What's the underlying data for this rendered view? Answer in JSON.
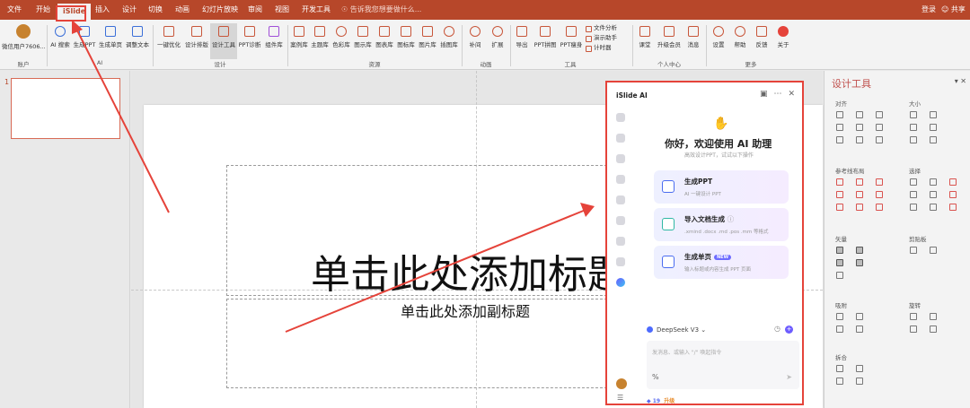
{
  "menubar": {
    "tabs": [
      "文件",
      "开始",
      "iSlide",
      "插入",
      "设计",
      "切换",
      "动画",
      "幻灯片放映",
      "审阅",
      "视图",
      "开发工具"
    ],
    "active_tab": "iSlide",
    "search_placeholder": "告诉我您想要做什么...",
    "login": "登录",
    "share": "共享"
  },
  "ribbon": {
    "account": {
      "user": "微信用户7606...",
      "group": "账户"
    },
    "ai": {
      "items": [
        "AI 搜索",
        "生成PPT",
        "生成单页",
        "调整文本"
      ],
      "group": "AI"
    },
    "design": {
      "items": [
        "一键优化",
        "设计排版",
        "设计工具",
        "PPT诊断",
        "组件库"
      ],
      "group": "设计"
    },
    "resources": {
      "items": [
        "案例库",
        "主题库",
        "色彩库",
        "图示库",
        "图表库",
        "图标库",
        "图片库",
        "插图库"
      ],
      "group": "资源"
    },
    "animation": {
      "items": [
        "补间",
        "扩展"
      ],
      "group": "动画"
    },
    "tools": {
      "items": [
        "导出",
        "PPT拼图",
        "PPT瘦身"
      ],
      "list": [
        "文件分析",
        "演示助手",
        "计时器"
      ],
      "group": "工具"
    },
    "personal": {
      "items": [
        "课堂",
        "升级会员",
        "消息"
      ],
      "group": "个人中心"
    },
    "more": {
      "items": [
        "设置",
        "帮助",
        "反馈",
        "关于"
      ],
      "group": "更多"
    }
  },
  "thumbnails": {
    "slide_number": "1"
  },
  "slide": {
    "title": "单击此处添加标题",
    "subtitle": "单击此处添加副标题"
  },
  "ai_panel": {
    "title": "iSlide AI",
    "greeting_icon": "waving-hand-icon",
    "greeting": "你好，欢迎使用 AI 助理",
    "hint": "高效设计PPT，试试以下操作",
    "cards": [
      {
        "title": "生成PPT",
        "desc": "AI 一键设计 PPT",
        "badge": ""
      },
      {
        "title": "导入文档生成",
        "desc": ".xmind .docx .md .pos .mm 等格式",
        "badge": ""
      },
      {
        "title": "生成单页",
        "desc": "输入标题或内容生成 PPT 页面",
        "badge": "NEW"
      }
    ],
    "model": "DeepSeek V3",
    "input_placeholder": "发消息、或输入 \"/\" 唤起指令",
    "input_prefix": "%",
    "points": "19",
    "points_label": "升级"
  },
  "design_tools": {
    "title": "设计工具",
    "sections": [
      "对齐",
      "大小",
      "参考线布局",
      "选择",
      "矢量",
      "剪贴板",
      "吸附",
      "旋转",
      "拆合"
    ]
  },
  "colors": {
    "accent": "#b7472a",
    "highlight": "#e5433a",
    "ai_brand": "#6d6bff"
  }
}
